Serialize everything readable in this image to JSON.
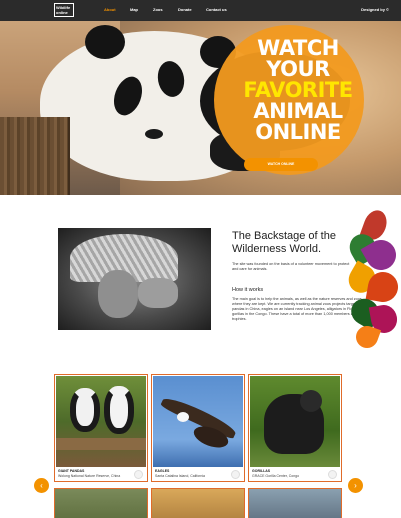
{
  "nav": {
    "logo": "Wildlife online",
    "items": [
      "About",
      "Map",
      "Zoos",
      "Donate",
      "Contact us"
    ],
    "active_index": 0,
    "designed_by": "Designed by ©"
  },
  "hero": {
    "headline_line1": "WATCH",
    "headline_line2": "YOUR",
    "headline_highlight": "FAVORITE",
    "headline_line4": "ANIMAL",
    "headline_line5": "ONLINE",
    "button_label": "WATCH ONLINE",
    "colors": {
      "accent": "#f39200",
      "highlight": "#ffe600"
    }
  },
  "about": {
    "title": "The Backstage of the Wilderness World.",
    "paragraph": "The site was founded on the basis of a volunteer movement to protect and care for animals.",
    "how_title": "How it works",
    "how_paragraph": "The main goal is to help the animals, as well as the nature reserves and zoos where they are kept. We are currently tracking animal zoos projects targeting pandas in China, eagles on an island near Los Angeles, alligators in Florida and gorillas in the Congo. These have a total of more than 1,000 members and trophies."
  },
  "gallery": {
    "cards": [
      {
        "name": "GIANT PANDAS",
        "location": "Wolong National Nature Reserve, China",
        "icon": "panda-icon"
      },
      {
        "name": "EAGLES",
        "location": "Santa Catalina Island, California",
        "icon": "eagle-icon"
      },
      {
        "name": "GORILLAS",
        "location": "GRACE Gorilla Center, Congo",
        "icon": "gorilla-icon"
      }
    ],
    "prev_icon": "chevron-left-icon",
    "next_icon": "chevron-right-icon"
  }
}
